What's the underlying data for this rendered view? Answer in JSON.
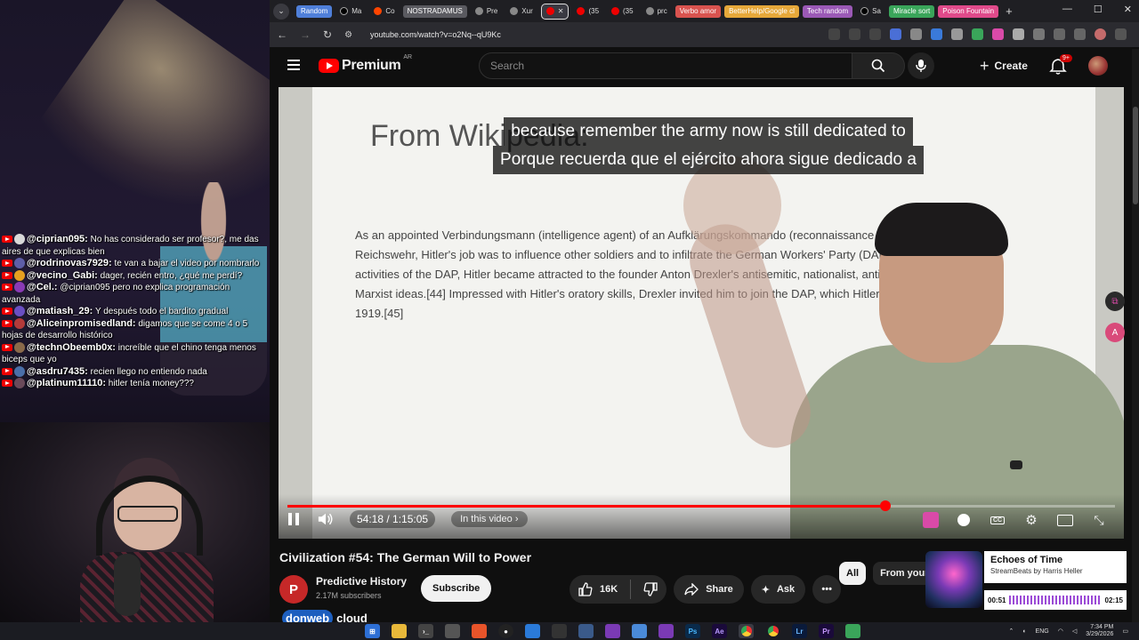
{
  "chat": [
    {
      "user": "@ciprian095:",
      "text": "No has considerado ser profesor?, me das aires de que explicas bien",
      "avatar_color": "#d9d9d9"
    },
    {
      "user": "@rodrinovas7929:",
      "text": "te van a bajar el video por nombrarlo",
      "avatar_color": "#5e5ea8",
      "avatar_letter": "R"
    },
    {
      "user": "@vecino_Gabi:",
      "text": "dager, recién entro, ¿qué me perdí?",
      "avatar_color": "#e6a020"
    },
    {
      "user": "@Cel.:",
      "text": "@ciprian095 pero no explica programación avanzada",
      "avatar_color": "#8a3ab5"
    },
    {
      "user": "@matiash_29:",
      "text": "Y después todo el bardito gradual",
      "avatar_color": "#6a4fc2"
    },
    {
      "user": "@Aliceinpromisedland:",
      "text": "digamos que se come 4 o 5 hojas de desarrollo histórico",
      "avatar_color": "#b33a3a"
    },
    {
      "user": "@technObeemb0x:",
      "text": "increíble que el chino tenga menos biceps que yo",
      "avatar_color": "#8a6a4a"
    },
    {
      "user": "@asdru7435:",
      "text": "recien llego no entiendo nada",
      "avatar_color": "#4a6fa8"
    },
    {
      "user": "@platinum11110:",
      "text": "hitler tenía money???",
      "avatar_color": "#6a4a5a",
      "avatar_letter": "P"
    }
  ],
  "browser": {
    "tabs": [
      {
        "label": "Random",
        "type": "group",
        "color": "#4f7fd9"
      },
      {
        "label": "Ma",
        "icon": "x-icon"
      },
      {
        "label": "Co",
        "icon": "reddit-icon"
      },
      {
        "label": "NOSTRADAMUS",
        "type": "group",
        "color": "#5a5a60"
      },
      {
        "label": "Pre",
        "icon": "globe-icon"
      },
      {
        "label": "Xur",
        "icon": "chat-icon"
      },
      {
        "label": "",
        "icon": "youtube-icon",
        "active": true
      },
      {
        "label": "(35",
        "icon": "youtube-icon"
      },
      {
        "label": "(35",
        "icon": "youtube-icon"
      },
      {
        "label": "prc",
        "icon": "globe-icon"
      },
      {
        "label": "Verbo amor",
        "type": "group",
        "color": "#d9534f"
      },
      {
        "label": "BetterHelp/Google cl",
        "type": "group",
        "color": "#e6a83a"
      },
      {
        "label": "Tech random",
        "type": "group",
        "color": "#9b59b6"
      },
      {
        "label": "Sa",
        "icon": "x-icon"
      },
      {
        "label": "Miracle sort",
        "type": "group",
        "color": "#3aa55a"
      },
      {
        "label": "Poison Fountain",
        "type": "group",
        "color": "#e04a8a"
      }
    ],
    "url": "youtube.com/watch?v=o2Nq--qU9Kc"
  },
  "youtube": {
    "logo_text": "Premium",
    "country": "AR",
    "search_placeholder": "Search",
    "create_label": "Create",
    "notif_count": "9+"
  },
  "video": {
    "slide_title": "From Wikipedia:",
    "slide_lines": [
      "As an appointed Verbindungsmann (intelligence agent) of an Aufklärungskommando (reconnaissance commando) of the",
      "Reichswehr, Hitler's job was to influence other soldiers and to infiltrate the German Workers' Party (DAP). While monitoring the",
      "activities of the DAP, Hitler became attracted to the founder Anton Drexler's antisemitic, nationalist, anti-capitalist, and anti-",
      "Marxist ideas.[44] Impressed with Hitler's oratory skills, Drexler invited him to join the DAP, which Hitler did on 12 September",
      "1919.[45]"
    ],
    "caption_en": "because remember the army now is still dedicated to",
    "caption_es": "Porque recuerda que el ejército ahora sigue dedicado a",
    "time": "54:18 / 1:15:05",
    "in_this_video": "In this video",
    "progress": 0.723,
    "title": "Civilization #54: The German Will to Power"
  },
  "channel": {
    "name": "Predictive History",
    "subs": "2.17M subscribers",
    "initial": "P",
    "subscribe": "Subscribe"
  },
  "actions": {
    "likes": "16K",
    "share": "Share",
    "ask": "Ask"
  },
  "chips": [
    "All",
    "From your"
  ],
  "now_playing": {
    "title": "Echoes of Time",
    "artist": "StreamBeats by Harris Heller",
    "elapsed": "00:51",
    "total": "02:15"
  },
  "overlay_logo": {
    "brand": "donweb",
    "suffix": "cloud"
  },
  "taskbar": {
    "lang": "ENG",
    "time": "7:34 PM",
    "date": "3/29/2026"
  }
}
